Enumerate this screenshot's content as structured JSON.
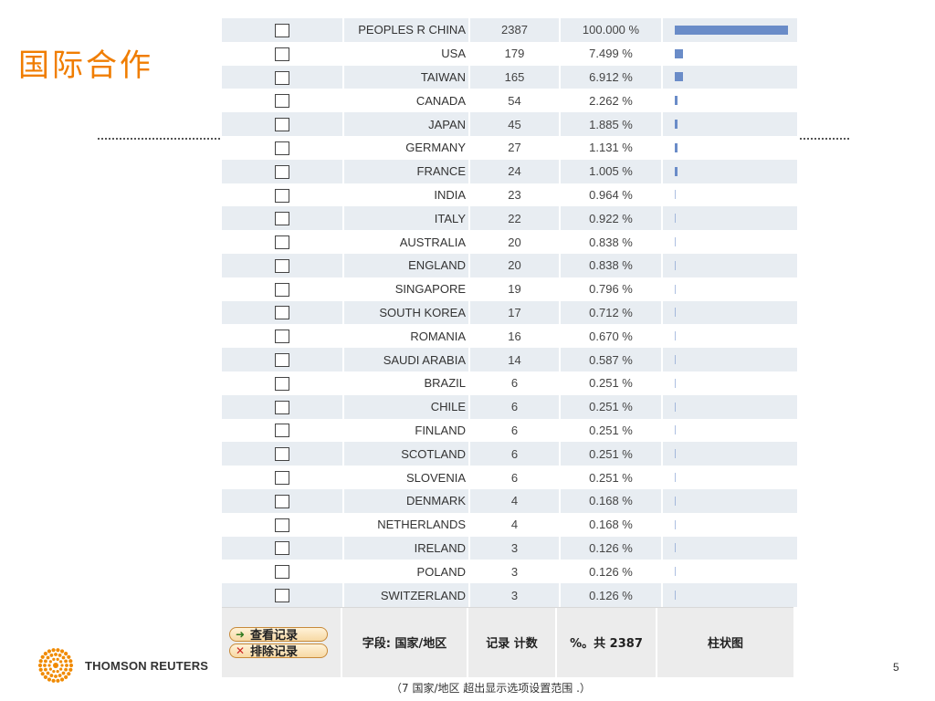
{
  "slide": {
    "title": "国际合作",
    "page_number": "5",
    "logo_text": "THOMSON REUTERS",
    "note": "（7 国家/地区  超出显示选项设置范围  .）"
  },
  "table": {
    "rows": [
      {
        "name": "PEOPLES R CHINA",
        "count": "2387",
        "pct": "100.000 %",
        "value": 100.0
      },
      {
        "name": "USA",
        "count": "179",
        "pct": "7.499 %",
        "value": 7.499
      },
      {
        "name": "TAIWAN",
        "count": "165",
        "pct": "6.912 %",
        "value": 6.912
      },
      {
        "name": "CANADA",
        "count": "54",
        "pct": "2.262 %",
        "value": 2.262
      },
      {
        "name": "JAPAN",
        "count": "45",
        "pct": "1.885 %",
        "value": 1.885
      },
      {
        "name": "GERMANY",
        "count": "27",
        "pct": "1.131 %",
        "value": 1.131
      },
      {
        "name": "FRANCE",
        "count": "24",
        "pct": "1.005 %",
        "value": 1.005
      },
      {
        "name": "INDIA",
        "count": "23",
        "pct": "0.964 %",
        "value": 0.964
      },
      {
        "name": "ITALY",
        "count": "22",
        "pct": "0.922 %",
        "value": 0.922
      },
      {
        "name": "AUSTRALIA",
        "count": "20",
        "pct": "0.838 %",
        "value": 0.838
      },
      {
        "name": "ENGLAND",
        "count": "20",
        "pct": "0.838 %",
        "value": 0.838
      },
      {
        "name": "SINGAPORE",
        "count": "19",
        "pct": "0.796 %",
        "value": 0.796
      },
      {
        "name": "SOUTH KOREA",
        "count": "17",
        "pct": "0.712 %",
        "value": 0.712
      },
      {
        "name": "ROMANIA",
        "count": "16",
        "pct": "0.670 %",
        "value": 0.67
      },
      {
        "name": "SAUDI ARABIA",
        "count": "14",
        "pct": "0.587 %",
        "value": 0.587
      },
      {
        "name": "BRAZIL",
        "count": "6",
        "pct": "0.251 %",
        "value": 0.251
      },
      {
        "name": "CHILE",
        "count": "6",
        "pct": "0.251 %",
        "value": 0.251
      },
      {
        "name": "FINLAND",
        "count": "6",
        "pct": "0.251 %",
        "value": 0.251
      },
      {
        "name": "SCOTLAND",
        "count": "6",
        "pct": "0.251 %",
        "value": 0.251
      },
      {
        "name": "SLOVENIA",
        "count": "6",
        "pct": "0.251 %",
        "value": 0.251
      },
      {
        "name": "DENMARK",
        "count": "4",
        "pct": "0.168 %",
        "value": 0.168
      },
      {
        "name": "NETHERLANDS",
        "count": "4",
        "pct": "0.168 %",
        "value": 0.168
      },
      {
        "name": "IRELAND",
        "count": "3",
        "pct": "0.126 %",
        "value": 0.126
      },
      {
        "name": "POLAND",
        "count": "3",
        "pct": "0.126 %",
        "value": 0.126
      },
      {
        "name": "SWITZERLAND",
        "count": "3",
        "pct": "0.126 %",
        "value": 0.126
      }
    ],
    "footer": {
      "view_records_label": "查看记录",
      "exclude_records_label": "排除记录",
      "field_label": "字段: 国家/地区",
      "count_label": "记录 计数",
      "pct_label": "%。共 2387",
      "chart_label": "柱状图"
    }
  },
  "colors": {
    "accent": "#f07d00",
    "bar": "#6a8cc8",
    "row_alt": "#e8edf2"
  }
}
